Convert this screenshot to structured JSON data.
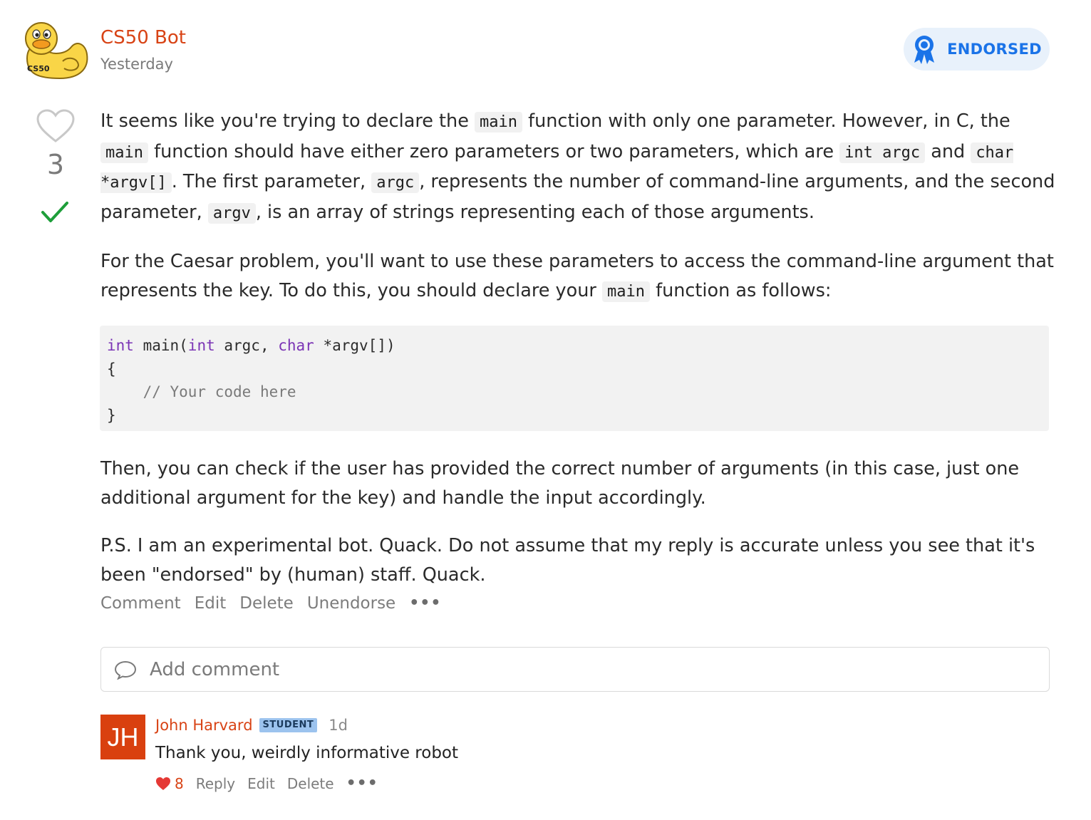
{
  "post": {
    "author": "CS50 Bot",
    "time": "Yesterday",
    "badge": "ENDORSED",
    "avatar_logo_text": "CS50",
    "vote_count": "3"
  },
  "body": {
    "p1": {
      "t1": "It seems like you're trying to declare the ",
      "c1": "main",
      "t2": " function with only one parameter. However, in C, the ",
      "c2": "main",
      "t3": " function should have either zero parameters or two parameters, which are ",
      "c3": "int argc",
      "t4": " and ",
      "c4": "char *argv[]",
      "t5": ". The first parameter, ",
      "c5": "argc",
      "t6": ", represents the number of command-line arguments, and the second parameter, ",
      "c6": "argv",
      "t7": ", is an array of strings representing each of those arguments."
    },
    "p2": {
      "t1": "For the Caesar problem, you'll want to use these parameters to access the command-line argument that represents the key. To do this, you should declare your ",
      "c1": "main",
      "t2": " function as follows:"
    },
    "code": {
      "l1_kw1": "int",
      "l1_t1": " main(",
      "l1_kw2": "int",
      "l1_t2": " argc, ",
      "l1_kw3": "char",
      "l1_t3": " *argv[])",
      "l2": "{",
      "l3_indent": "    ",
      "l3_comment": "// Your code here",
      "l4": "}"
    },
    "p3": "Then, you can check if the user has provided the correct number of arguments (in this case, just one additional argument for the key) and handle the input accordingly.",
    "p4": "P.S. I am an experimental bot. Quack. Do not assume that my reply is accurate unless you see that it's been \"endorsed\" by (human) staff. Quack."
  },
  "actions": {
    "comment": "Comment",
    "edit": "Edit",
    "delete": "Delete",
    "unendorse": "Unendorse",
    "more": "•••"
  },
  "add_comment": {
    "placeholder": "Add comment"
  },
  "comment": {
    "avatar_initials": "JH",
    "author": "John Harvard",
    "role_badge": "STUDENT",
    "time": "1d",
    "text": "Thank you, weirdly informative robot",
    "like_count": "8",
    "reply": "Reply",
    "edit": "Edit",
    "delete": "Delete",
    "more": "•••"
  },
  "colors": {
    "author_accent": "#d84315",
    "endorsed_blue": "#1a73e8",
    "check_green": "#1e9e3a",
    "code_keyword": "#7b34b5",
    "avatar_bg": "#d9400f",
    "student_badge_bg": "#9cc3ee"
  },
  "icons": {
    "avatar": "duck-avatar-icon",
    "badge": "award-ribbon-icon",
    "vote": "heart-outline-icon",
    "answer_mark": "checkmark-icon",
    "comment_input": "speech-bubble-icon",
    "like": "heart-filled-icon"
  }
}
